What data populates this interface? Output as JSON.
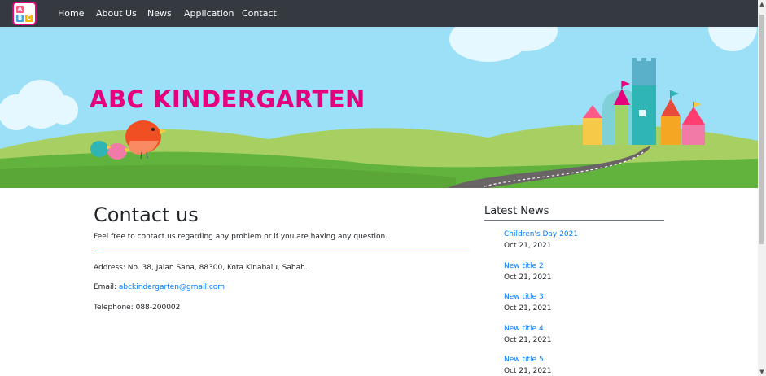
{
  "nav": {
    "logo_letters": [
      "A",
      "B",
      "C"
    ],
    "items": [
      "Home",
      "About Us",
      "News",
      "Application",
      "Contact"
    ]
  },
  "hero": {
    "title": "ABC KINDERGARTEN"
  },
  "main": {
    "heading": "Contact us",
    "lead": "Feel free to contact us regarding any problem or if you are having any question.",
    "address": "Address: No. 38, Jalan Sana, 88300, Kota Kinabalu, Sabah.",
    "email_label": "Email: ",
    "email": "abckindergarten@gmail.com",
    "telephone": "Telephone: 088-200002"
  },
  "sidebar": {
    "title": "Latest News",
    "items": [
      {
        "title": "Children's Day 2021",
        "date": "Oct 21, 2021"
      },
      {
        "title": "New title 2",
        "date": "Oct 21, 2021"
      },
      {
        "title": "New title 3",
        "date": "Oct 21, 2021"
      },
      {
        "title": "New title 4",
        "date": "Oct 21, 2021"
      },
      {
        "title": "New title 5",
        "date": "Oct 21, 2021"
      }
    ]
  },
  "colors": {
    "brand_pink": "#e6007e",
    "link_blue": "#007bff",
    "navbar": "#343a40",
    "sky": "#9be0f6",
    "grass": "#62b33d"
  }
}
